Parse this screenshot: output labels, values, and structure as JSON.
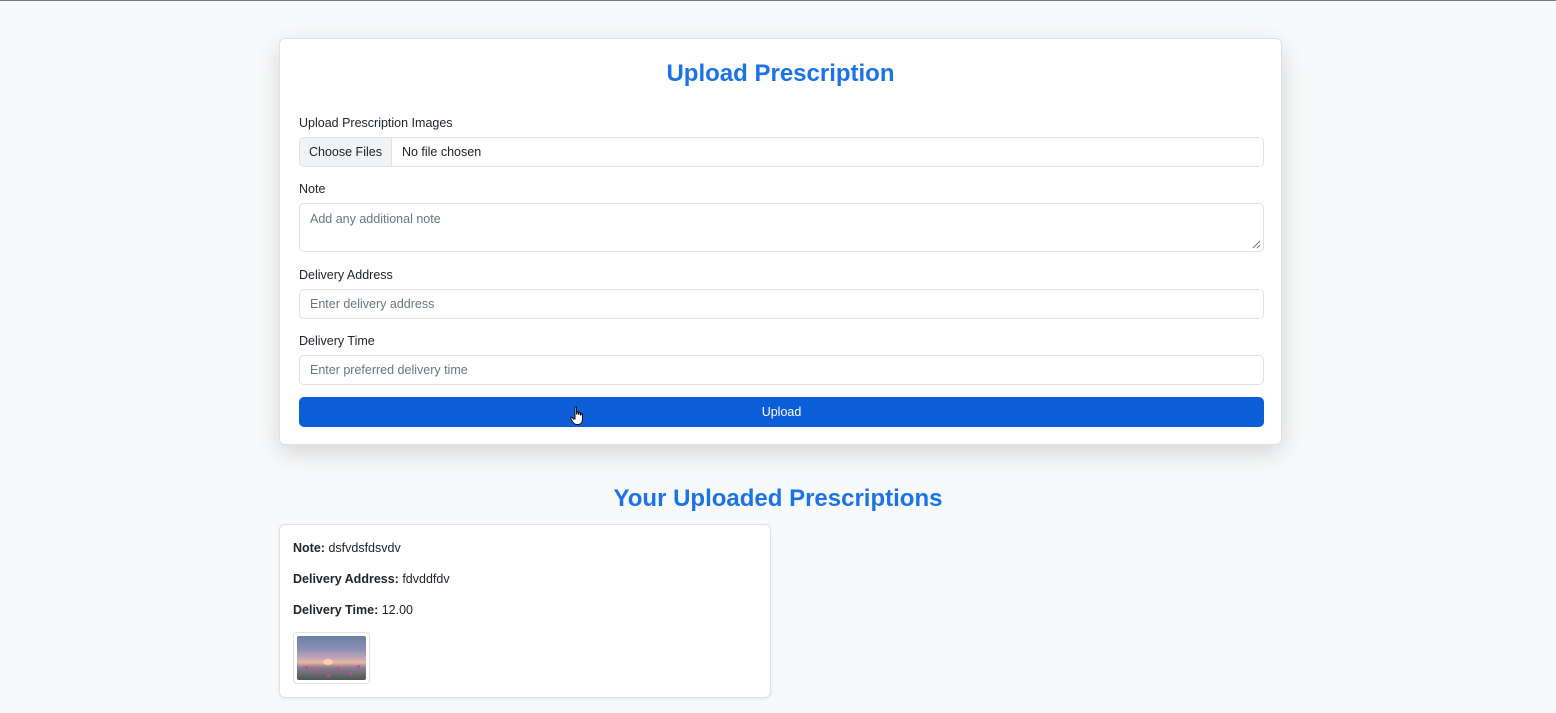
{
  "upload_form": {
    "title": "Upload Prescription",
    "images_label": "Upload Prescription Images",
    "file_button": "Choose Files",
    "file_status": "No file chosen",
    "note_label": "Note",
    "note_placeholder": "Add any additional note",
    "address_label": "Delivery Address",
    "address_placeholder": "Enter delivery address",
    "time_label": "Delivery Time",
    "time_placeholder": "Enter preferred delivery time",
    "submit_label": "Upload"
  },
  "uploaded": {
    "title": "Your Uploaded Prescriptions",
    "items": [
      {
        "note_key": "Note:",
        "note": "dsfvdsfdsvdv",
        "address_key": "Delivery Address:",
        "address": "fdvddfdv",
        "time_key": "Delivery Time:",
        "time": "12.00"
      }
    ]
  },
  "colors": {
    "accent": "#1a73e8",
    "button": "#0b5ed7",
    "background": "#f8f9fa"
  }
}
